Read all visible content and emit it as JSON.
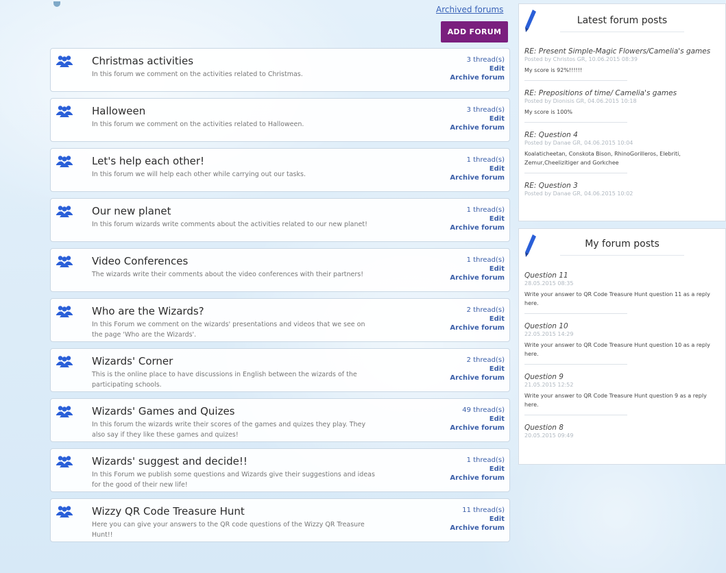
{
  "header": {
    "archived_link": "Archived forums",
    "add_forum_label": "ADD FORUM"
  },
  "forums": [
    {
      "title": "Christmas activities",
      "description": "In this forum we comment on the activities related to Christmas.",
      "threads": "3 thread(s)",
      "edit": "Edit",
      "archive": "Archive forum"
    },
    {
      "title": "Halloween",
      "description": "In this forum we comment on the activities related to Halloween.",
      "threads": "3 thread(s)",
      "edit": "Edit",
      "archive": "Archive forum"
    },
    {
      "title": "Let's help each other!",
      "description": "In this forum we will help each other while carrying out our tasks.",
      "threads": "1 thread(s)",
      "edit": "Edit",
      "archive": "Archive forum"
    },
    {
      "title": "Our new planet",
      "description": "In this forum wizards write comments about the activities related to our new planet!",
      "threads": "1 thread(s)",
      "edit": "Edit",
      "archive": "Archive forum"
    },
    {
      "title": "Video Conferences",
      "description": "The wizards write their comments about the video conferences with their partners!",
      "threads": "1 thread(s)",
      "edit": "Edit",
      "archive": "Archive forum"
    },
    {
      "title": "Who are the Wizards?",
      "description": "In this Forum we comment on the wizards' presentations and videos that we see on the page 'Who are the Wizards'.",
      "threads": "2 thread(s)",
      "edit": "Edit",
      "archive": "Archive forum"
    },
    {
      "title": "Wizards' Corner",
      "description": "This is the online place to have discussions in English between the wizards of the participating schools.",
      "threads": "2 thread(s)",
      "edit": "Edit",
      "archive": "Archive forum"
    },
    {
      "title": "Wizards' Games and Quizes",
      "description": "In this forum the wizards write their scores of the games and quizes they play. They also say if they like these games and quizes!",
      "threads": "49 thread(s)",
      "edit": "Edit",
      "archive": "Archive forum"
    },
    {
      "title": "Wizards' suggest and decide!!",
      "description": "In this Forum we publish some questions and Wizards give their suggestions and ideas for the good of their new life!",
      "threads": "1 thread(s)",
      "edit": "Edit",
      "archive": "Archive forum"
    },
    {
      "title": "Wizzy QR Code Treasure Hunt",
      "description": "Here you can give your answers to the QR code questions of the Wizzy QR Treasure Hunt!!",
      "threads": "11 thread(s)",
      "edit": "Edit",
      "archive": "Archive forum"
    }
  ],
  "latest_posts": {
    "title": "Latest forum posts",
    "items": [
      {
        "title": "RE: Present Simple-Magic Flowers/Camelia's games",
        "meta": "Posted by Christos GR, 10.06.2015 08:39",
        "body": "My score is 92%!!!!!!"
      },
      {
        "title": "RE: Prepositions of time/ Camelia's games",
        "meta": "Posted by Dionisis GR, 04.06.2015 10:18",
        "body": "My score is 100%"
      },
      {
        "title": "RE: Question 4",
        "meta": "Posted by Danae GR, 04.06.2015 10:04",
        "body": "Koalaticheetan, Conskota Bison, RhinoGorilleros, Elebriti, Zemur,Cheelizitiger and Gorkchee"
      },
      {
        "title": "RE: Question 3",
        "meta": "Posted by Danae GR, 04.06.2015 10:02",
        "body": ""
      }
    ]
  },
  "my_posts": {
    "title": "My forum posts",
    "items": [
      {
        "title": "Question 11",
        "meta": "28.05.2015 08:35",
        "body": "Write your answer to QR Code Treasure Hunt question 11 as a reply here."
      },
      {
        "title": "Question 10",
        "meta": "22.05.2015 14:29",
        "body": "Write your answer to QR Code Treasure Hunt question 10 as a reply here."
      },
      {
        "title": "Question 9",
        "meta": "21.05.2015 12:52",
        "body": "Write your answer to QR Code Treasure Hunt question 9 as a reply here."
      },
      {
        "title": "Question 8",
        "meta": "20.05.2015 09:49",
        "body": ""
      }
    ]
  },
  "colors": {
    "accent_purple": "#7a1f7e",
    "link_blue": "#3a5ea8",
    "icon_blue": "#2a5fd8"
  }
}
